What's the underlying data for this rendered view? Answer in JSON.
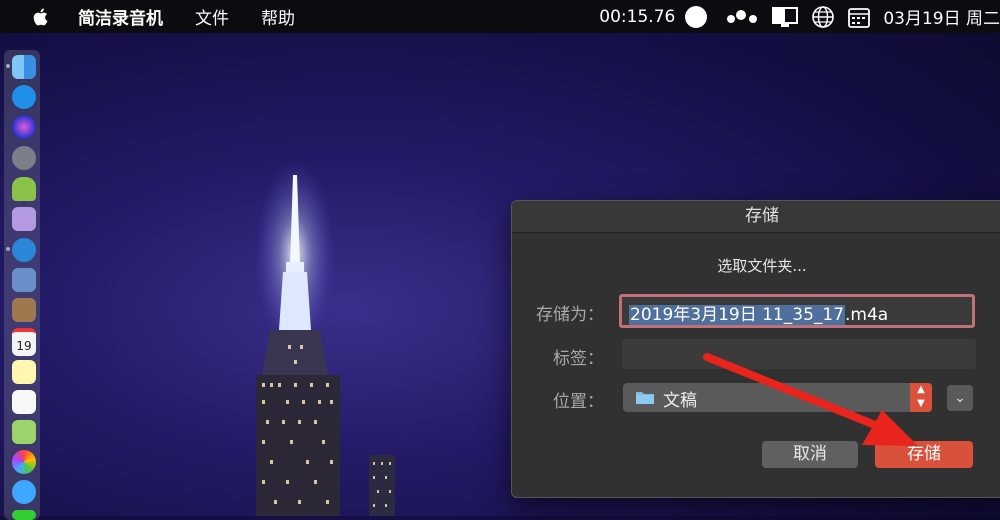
{
  "menubar": {
    "app_name": "简洁录音机",
    "menus": [
      "文件",
      "帮助"
    ],
    "timer": "00:15.76",
    "clock": "03月19日 周二"
  },
  "dialog": {
    "title": "存储",
    "choose_folder": "选取文件夹...",
    "save_as_label": "存储为：",
    "filename_selected": "2019年3月19日 11_35_17",
    "filename_ext": ".m4a",
    "tags_label": "标签：",
    "tags_value": "",
    "location_label": "位置：",
    "location_value": "文稿",
    "cancel_label": "取消",
    "save_label": "存储"
  },
  "dock": {
    "calendar_day": "19"
  },
  "colors": {
    "accent": "#d9503b",
    "selection": "#4f6f9c",
    "focus_ring": "#c0707a",
    "annotation_arrow": "#e8241c"
  }
}
